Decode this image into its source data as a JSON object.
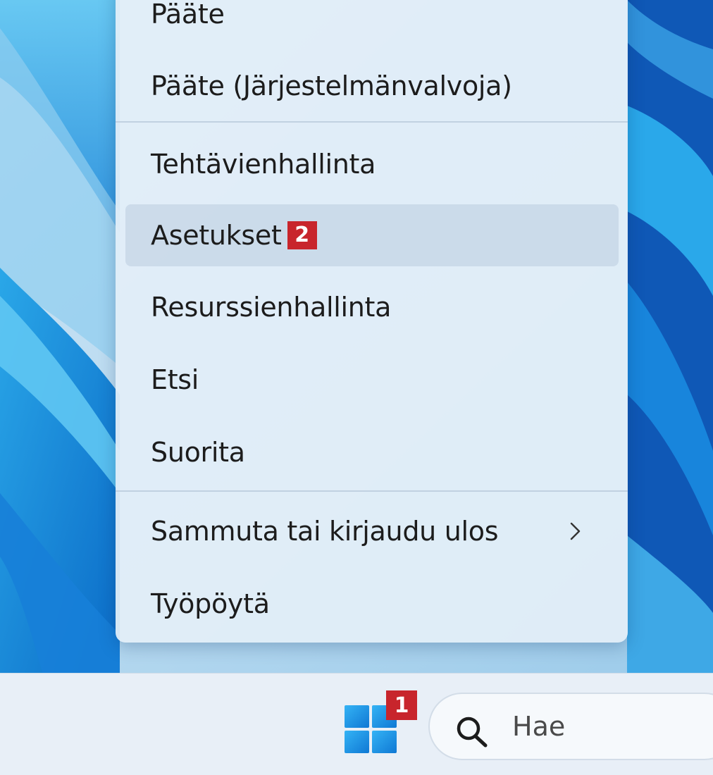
{
  "context_menu": {
    "items": [
      {
        "label": "Pääte"
      },
      {
        "label": "Pääte (Järjestelmänvalvoja)"
      },
      {
        "label": "Tehtävienhallinta"
      },
      {
        "label": "Asetukset",
        "badge": "2"
      },
      {
        "label": "Resurssienhallinta"
      },
      {
        "label": "Etsi"
      },
      {
        "label": "Suorita"
      },
      {
        "label": "Sammuta tai kirjaudu ulos"
      },
      {
        "label": "Työpöytä"
      }
    ],
    "hovered_item": "Asetukset"
  },
  "taskbar": {
    "start_badge": "1",
    "search": {
      "placeholder": "Hae"
    }
  },
  "icons": {
    "start": "windows-logo-icon",
    "search": "search-icon",
    "submenu": "chevron-right-icon"
  },
  "colors": {
    "badge": "#c8252c",
    "menu_background": "#e2eef8",
    "taskbar_background": "#e8eff7",
    "windows_logo": "#1a8fe0"
  }
}
